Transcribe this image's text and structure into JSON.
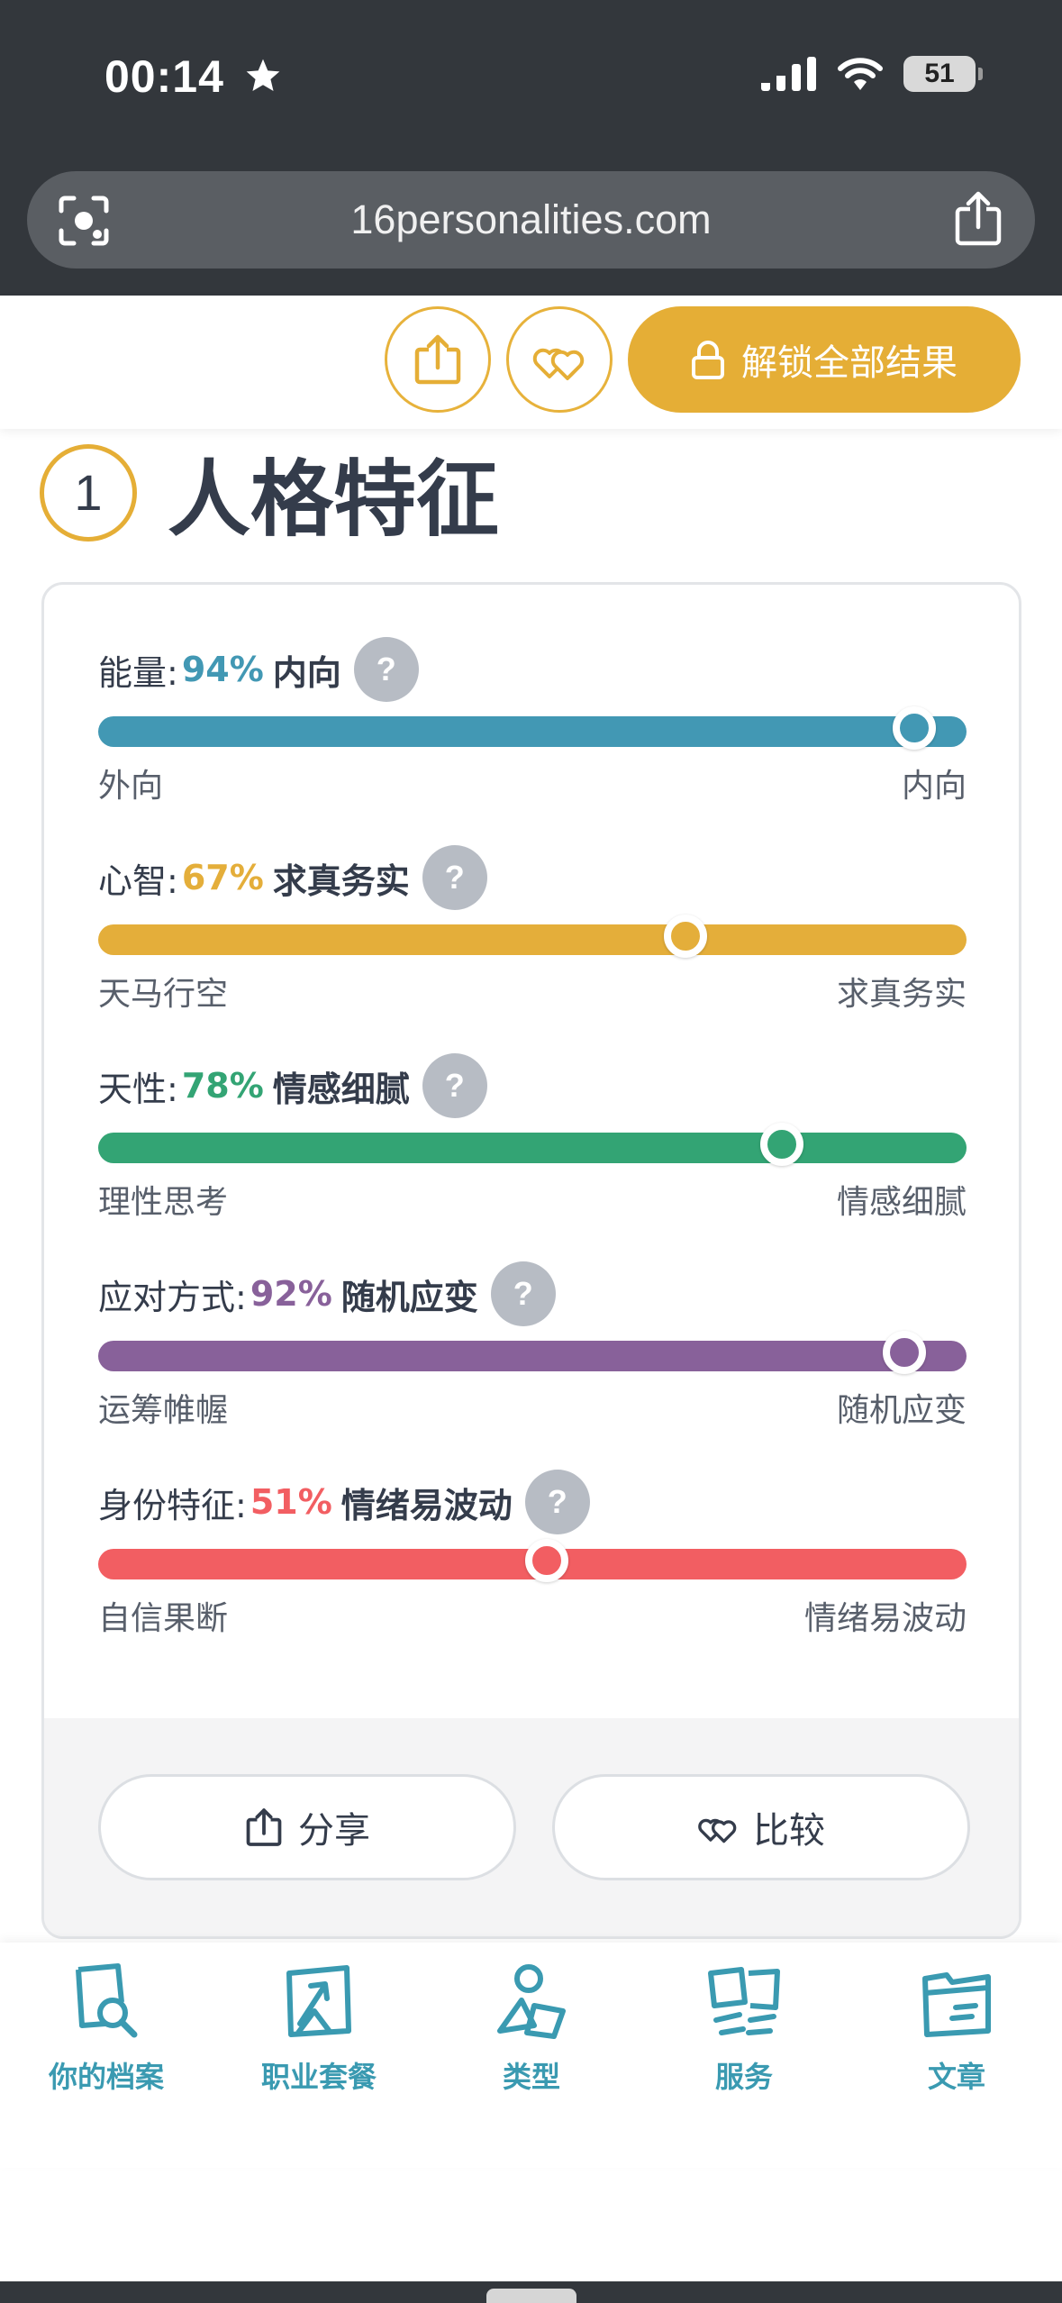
{
  "status": {
    "time": "00:14",
    "battery": "51"
  },
  "browser": {
    "url": "16personalities.com"
  },
  "actionbar": {
    "unlock_label": "解锁全部结果"
  },
  "section": {
    "number": "1",
    "title": "人格特征"
  },
  "colors": {
    "energy": "#4298b4",
    "mind": "#e4ae3a",
    "nature": "#33a474",
    "tactics": "#88619a",
    "identity": "#f25e62",
    "accent": "#e5ae36",
    "nav": "#3a9ab1"
  },
  "traits": [
    {
      "label": "能量:",
      "percent": "94%",
      "result": "内向",
      "left": "外向",
      "right": "内向",
      "value": 0.94
    },
    {
      "label": "心智:",
      "percent": "67%",
      "result": "求真务实",
      "left": "天马行空",
      "right": "求真务实",
      "value": 0.676
    },
    {
      "label": "天性:",
      "percent": "78%",
      "result": "情感细腻",
      "left": "理性思考",
      "right": "情感细腻",
      "value": 0.787
    },
    {
      "label": "应对方式:",
      "percent": "92%",
      "result": "随机应变",
      "left": "运筹帷幄",
      "right": "随机应变",
      "value": 0.928
    },
    {
      "label": "身份特征:",
      "percent": "51%",
      "result": "情绪易波动",
      "left": "自信果断",
      "right": "情绪易波动",
      "value": 0.517
    }
  ],
  "help_symbol": "?",
  "footer": {
    "share_label": "分享",
    "compare_label": "比较"
  },
  "nav": [
    {
      "label": "你的档案",
      "icon": "profile-search-icon"
    },
    {
      "label": "职业套餐",
      "icon": "career-arrow-icon"
    },
    {
      "label": "类型",
      "icon": "types-shapes-icon"
    },
    {
      "label": "服务",
      "icon": "services-icon"
    },
    {
      "label": "文章",
      "icon": "articles-folder-icon"
    }
  ]
}
